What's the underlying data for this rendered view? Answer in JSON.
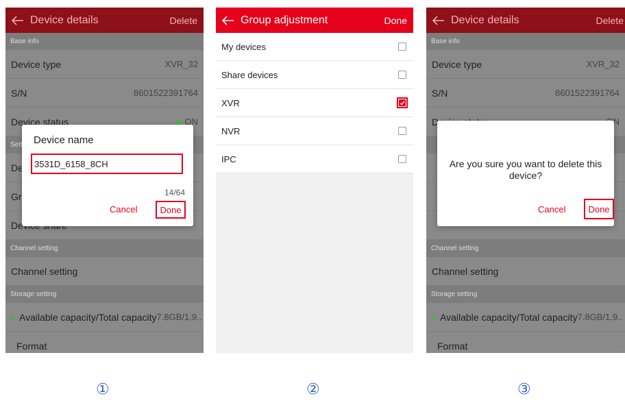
{
  "screen1": {
    "title": "Device details",
    "action": "Delete",
    "base_info": "Base info",
    "device_type_label": "Device type",
    "device_type_value": "XVR_32",
    "sn_label": "S/N",
    "sn_value": "8601522391764",
    "status_label": "Device status",
    "status_value": "ON",
    "settings_section": "Setting",
    "device_name_label": "Device name",
    "group_label": "Group",
    "share_label": "Device share",
    "channel_section": "Channel setting",
    "channel_label": "Channel setting",
    "storage_section": "Storage setting",
    "capacity_label": "Available capacity/Total capacity",
    "capacity_value": "7.8GB/1.9..",
    "format_label": "Format",
    "dialog": {
      "title": "Device name",
      "value": "3531D_6158_8CH",
      "counter": "14/64",
      "cancel": "Cancel",
      "done": "Done"
    }
  },
  "screen2": {
    "title": "Group adjustment",
    "action": "Done",
    "groups": [
      {
        "label": "My devices",
        "checked": false
      },
      {
        "label": "Share devices",
        "checked": false
      },
      {
        "label": "XVR",
        "checked": true
      },
      {
        "label": "NVR",
        "checked": false
      },
      {
        "label": "IPC",
        "checked": false
      }
    ]
  },
  "screen3": {
    "title": "Device details",
    "action": "Delete",
    "base_info": "Base info",
    "device_type_label": "Device type",
    "device_type_value": "XVR_32",
    "sn_label": "S/N",
    "sn_value": "8601522391764",
    "status_label": "Device status",
    "status_value": "ON",
    "channel_section": "Channel setting",
    "channel_label": "Channel setting",
    "storage_section": "Storage setting",
    "capacity_label": "Available capacity/Total capacity",
    "capacity_value": "7.8GB/1.9..",
    "format_label": "Format",
    "dialog": {
      "message": "Are you sure you want to delete this device?",
      "cancel": "Cancel",
      "done": "Done"
    }
  },
  "labels": {
    "step1": "①",
    "step2": "②",
    "step3": "③"
  },
  "colors": {
    "brand": "#e5001b",
    "online": "#3dbb3d",
    "step_number": "#3366cc"
  }
}
